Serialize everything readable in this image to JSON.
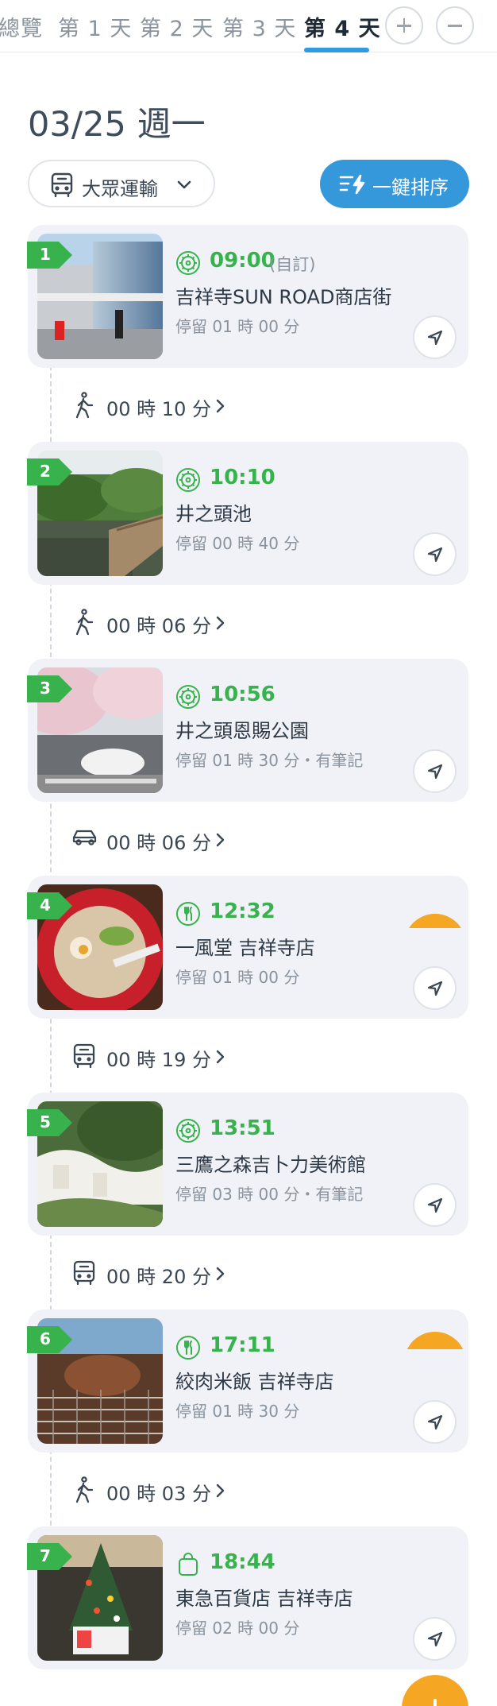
{
  "tabs": [
    {
      "label": "總覽",
      "active": false
    },
    {
      "label": "第 1 天",
      "active": false
    },
    {
      "label": "第 2 天",
      "active": false
    },
    {
      "label": "第 3 天",
      "active": false
    },
    {
      "label": "第 4 天",
      "active": true
    }
  ],
  "header": {
    "date": "03/25 週一",
    "transport_label": "大眾運輸",
    "sort_label": "一鍵排序"
  },
  "accent_colors": {
    "primary": "#3498db",
    "green": "#37b24d",
    "orange": "#f5a623"
  },
  "stops": [
    {
      "num": "1",
      "type_icon": "attraction-icon",
      "time": "09:00",
      "time_note": "(自訂)",
      "name": "吉祥寺SUN ROAD商店街",
      "stay": "停留 01 時 00 分"
    },
    {
      "num": "2",
      "type_icon": "attraction-icon",
      "time": "10:10",
      "time_note": "",
      "name": "井之頭池",
      "stay": "停留 00 時 40 分"
    },
    {
      "num": "3",
      "type_icon": "attraction-icon",
      "time": "10:56",
      "time_note": "",
      "name": "井之頭恩賜公園",
      "stay": "停留 01 時 30 分・有筆記"
    },
    {
      "num": "4",
      "type_icon": "restaurant-icon",
      "time": "12:32",
      "time_note": "",
      "name": "一風堂 吉祥寺店",
      "stay": "停留 01 時 00 分"
    },
    {
      "num": "5",
      "type_icon": "attraction-icon",
      "time": "13:51",
      "time_note": "",
      "name": "三鷹之森吉卜力美術館",
      "stay": "停留 03 時 00 分・有筆記"
    },
    {
      "num": "6",
      "type_icon": "restaurant-icon",
      "time": "17:11",
      "time_note": "",
      "name": "絞肉米飯 吉祥寺店",
      "stay": "停留 01 時 30 分"
    },
    {
      "num": "7",
      "type_icon": "shopping-icon",
      "time": "18:44",
      "time_note": "",
      "name": "東急百貨店 吉祥寺店",
      "stay": "停留 02 時 00 分"
    }
  ],
  "transits": [
    {
      "mode_icon": "walk-icon",
      "duration": "00 時 10 分"
    },
    {
      "mode_icon": "walk-icon",
      "duration": "00 時 06 分"
    },
    {
      "mode_icon": "car-icon",
      "duration": "00 時 06 分"
    },
    {
      "mode_icon": "bus-icon",
      "duration": "00 時 19 分"
    },
    {
      "mode_icon": "bus-icon",
      "duration": "00 時 20 分"
    },
    {
      "mode_icon": "walk-icon",
      "duration": "00 時 03 分"
    }
  ]
}
